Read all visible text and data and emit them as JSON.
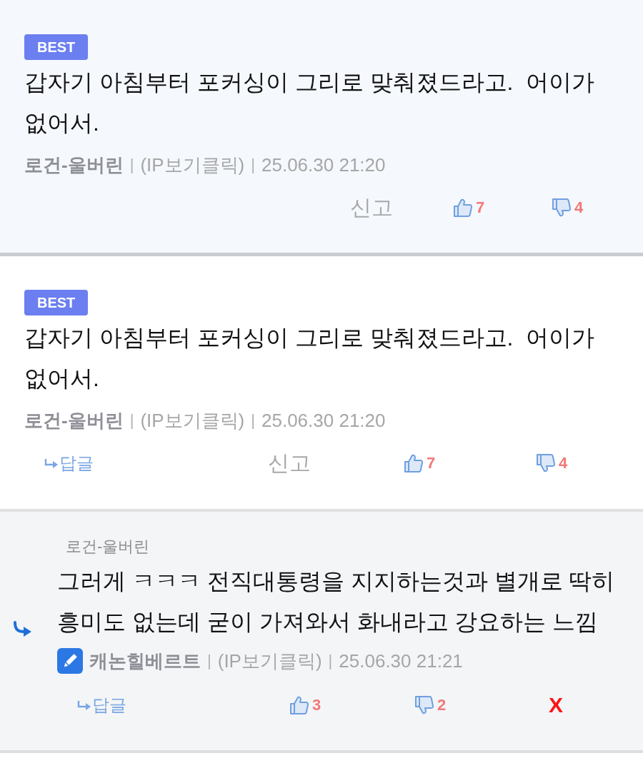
{
  "comments": [
    {
      "kind": "best_pick",
      "badge": "BEST",
      "body": "갑자기 아침부터 포커싱이 그리로 맞춰졌드라고.  어이가 없어서.",
      "is_writer": false,
      "author": "로건-울버린",
      "meta": [
        {
          "kind": "divider",
          "text": "|"
        },
        {
          "kind": "ip",
          "text": "(IP보기클릭)"
        },
        {
          "kind": "divider",
          "text": "|"
        },
        {
          "kind": "date",
          "text": "25.06.30 21:20"
        }
      ],
      "actions": [
        {
          "kind": "report",
          "label": "신고"
        },
        {
          "kind": "like",
          "label": "7"
        },
        {
          "kind": "dislike",
          "label": "4"
        }
      ]
    },
    {
      "kind": "comment",
      "badge": "BEST",
      "body": "갑자기 아침부터 포커싱이 그리로 맞춰졌드라고.  어이가 없어서.",
      "is_writer": false,
      "author": "로건-울버린",
      "meta": [
        {
          "kind": "divider",
          "text": "|"
        },
        {
          "kind": "ip",
          "text": "(IP보기클릭)"
        },
        {
          "kind": "divider",
          "text": "|"
        },
        {
          "kind": "date",
          "text": "25.06.30 21:20"
        }
      ],
      "actions": [
        {
          "kind": "reply",
          "label": "답글"
        },
        {
          "kind": "report",
          "label": "신고"
        },
        {
          "kind": "like",
          "label": "7"
        },
        {
          "kind": "dislike",
          "label": "4"
        }
      ]
    },
    {
      "kind": "reply",
      "reply_to": "로건-울버린",
      "body": "그러게 ㅋㅋㅋ 전직대통령을 지지하는것과 별개로 딱히 흥미도 없는데 굳이 가져와서 화내라고 강요하는 느낌",
      "is_writer": true,
      "author": "캐논힐베르트",
      "meta": [
        {
          "kind": "divider",
          "text": "|"
        },
        {
          "kind": "ip",
          "text": "(IP보기클릭)"
        },
        {
          "kind": "divider",
          "text": "|"
        },
        {
          "kind": "date",
          "text": "25.06.30 21:21"
        }
      ],
      "actions": [
        {
          "kind": "reply",
          "label": "답글"
        },
        {
          "kind": "like",
          "label": "3"
        },
        {
          "kind": "dislike",
          "label": "2"
        },
        {
          "kind": "delete",
          "label": "X"
        }
      ]
    }
  ]
}
